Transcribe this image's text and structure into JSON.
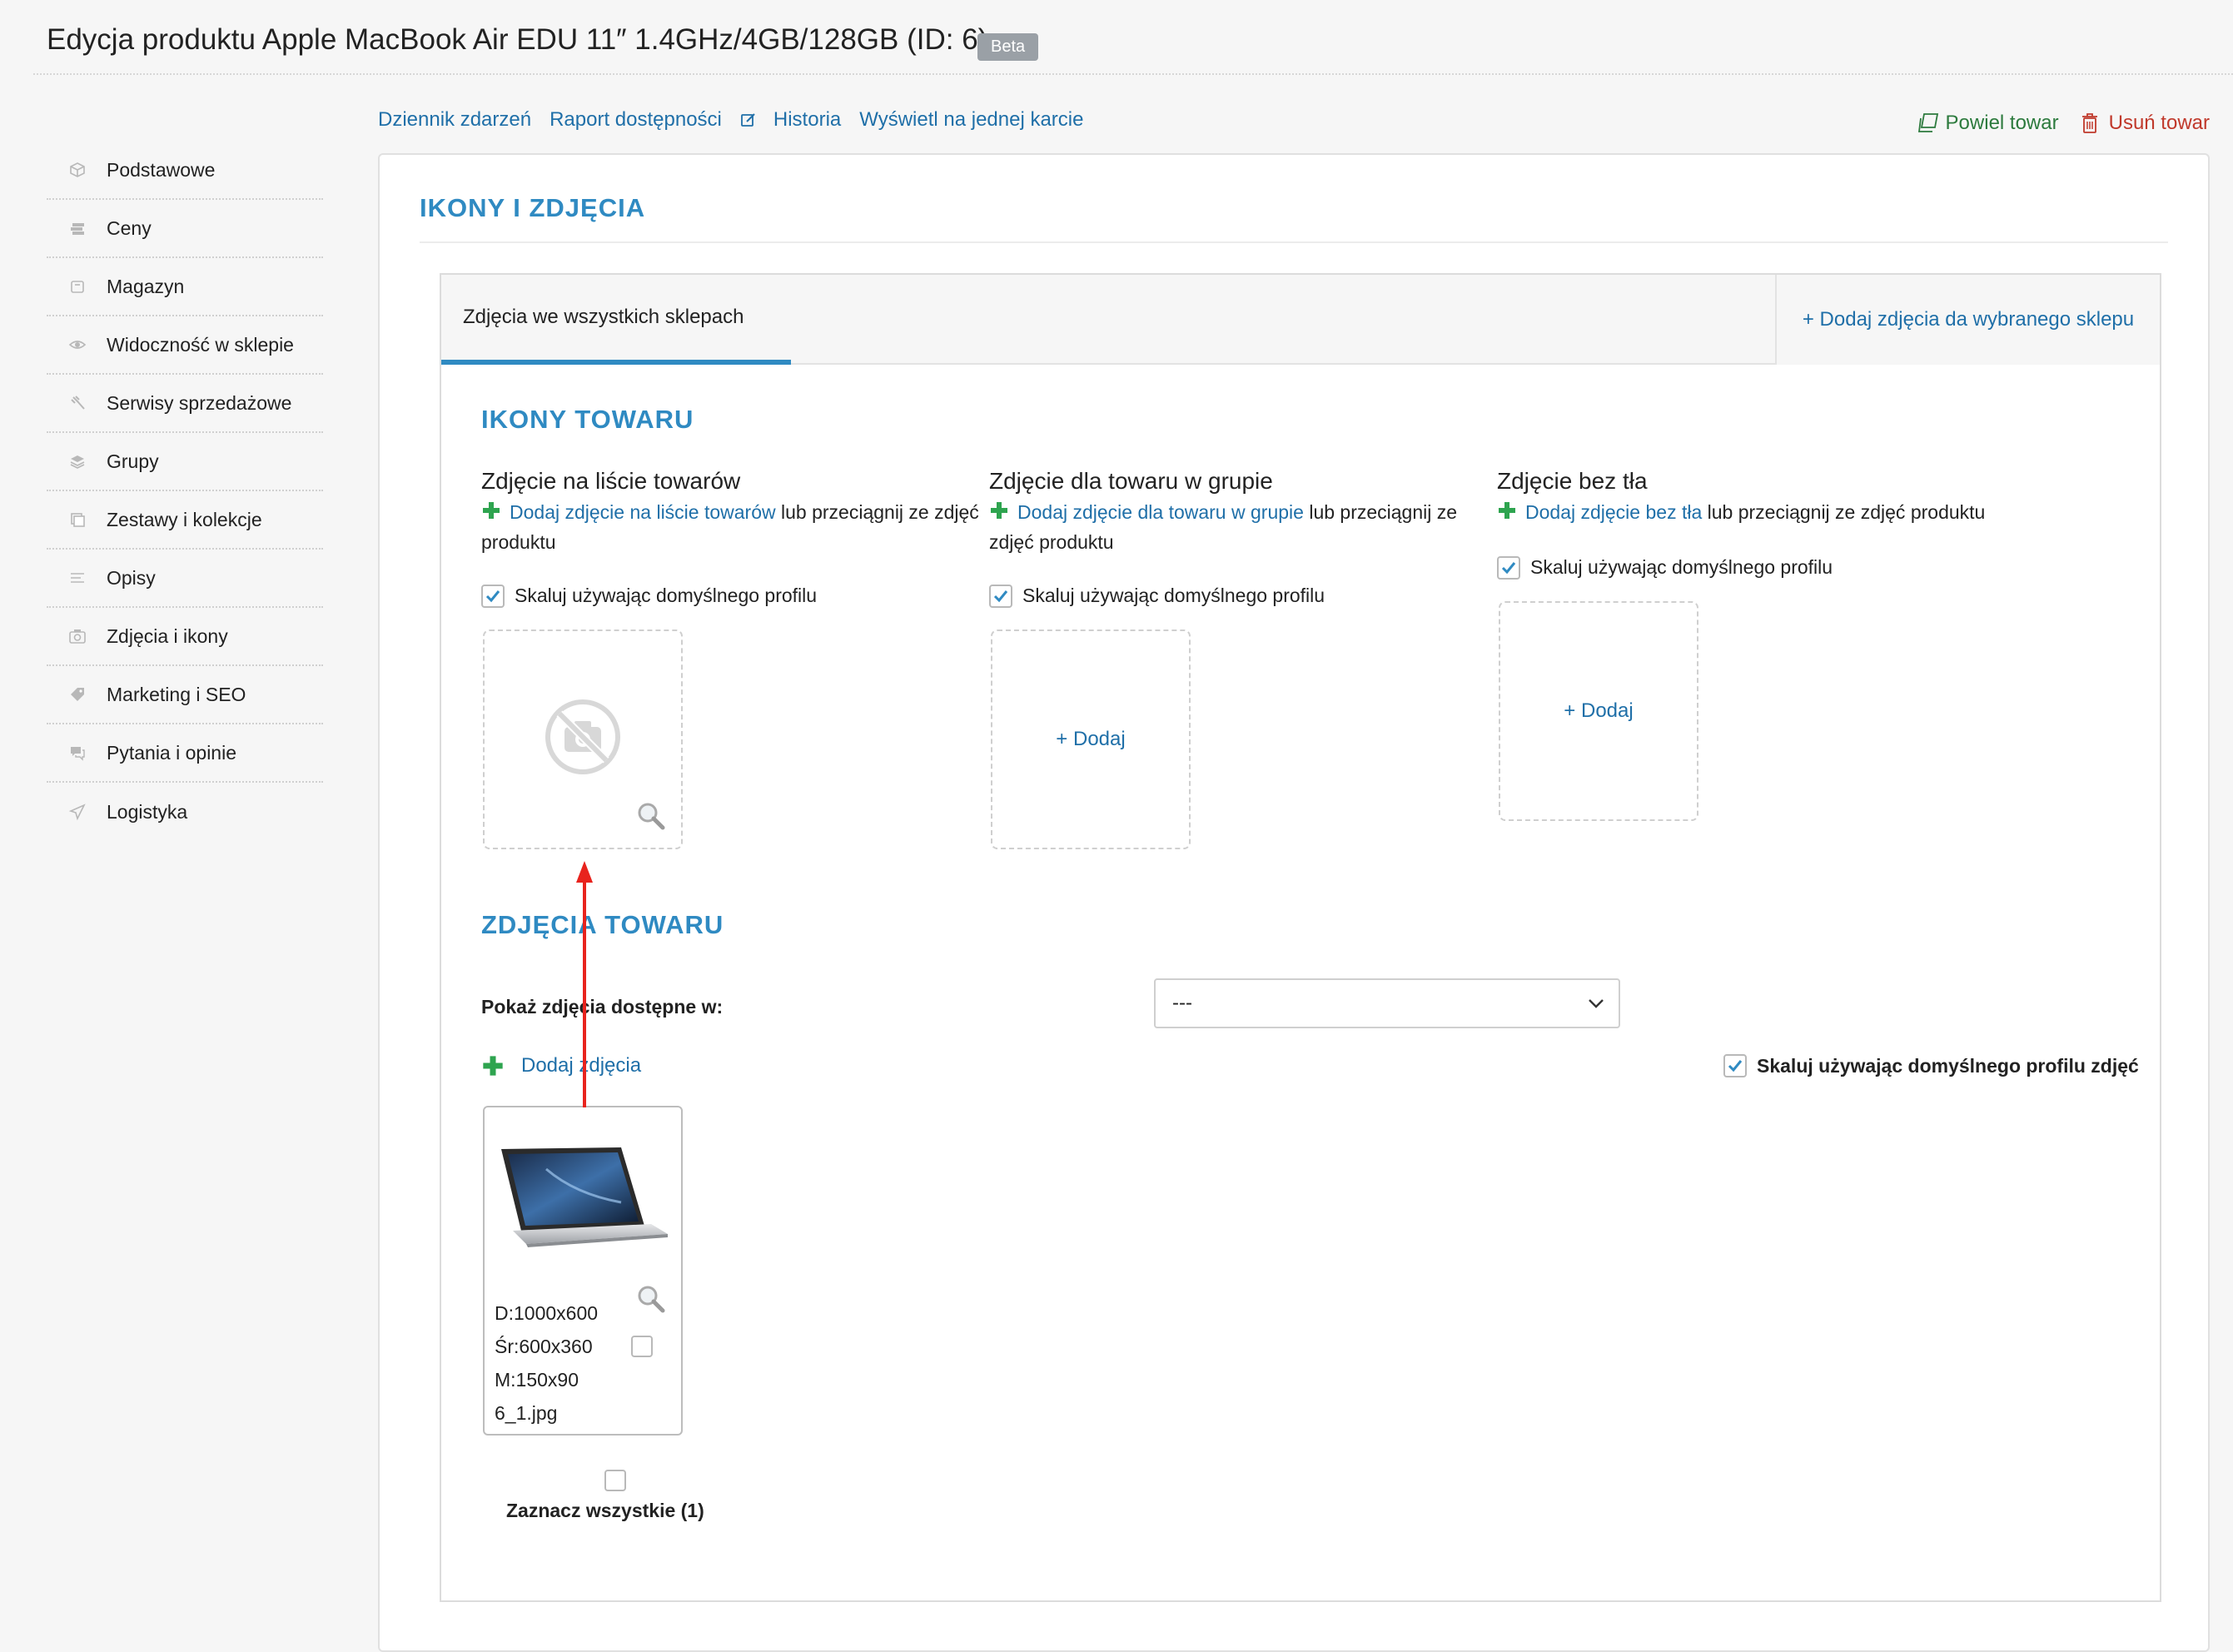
{
  "header": {
    "title": "Edycja produktu Apple MacBook Air EDU 11″ 1.4GHz/4GB/128GB (ID: 6)",
    "badge": "Beta"
  },
  "sidebar": {
    "items": [
      {
        "label": "Podstawowe",
        "icon": "box-icon"
      },
      {
        "label": "Ceny",
        "icon": "money-icon"
      },
      {
        "label": "Magazyn",
        "icon": "warehouse-icon"
      },
      {
        "label": "Widoczność w sklepie",
        "icon": "eye-icon"
      },
      {
        "label": "Serwisy sprzedażowe",
        "icon": "gavel-icon"
      },
      {
        "label": "Grupy",
        "icon": "layers-icon"
      },
      {
        "label": "Zestawy i kolekcje",
        "icon": "collection-icon"
      },
      {
        "label": "Opisy",
        "icon": "text-lines-icon"
      },
      {
        "label": "Zdjęcia i ikony",
        "icon": "camera-icon"
      },
      {
        "label": "Marketing i SEO",
        "icon": "tag-icon"
      },
      {
        "label": "Pytania i opinie",
        "icon": "chat-icon"
      },
      {
        "label": "Logistyka",
        "icon": "paper-plane-icon"
      }
    ]
  },
  "top_links": {
    "event_log": "Dziennik zdarzeń",
    "availability_report": "Raport dostępności",
    "history": "Historia",
    "single_card": "Wyświetl na jednej karcie"
  },
  "actions": {
    "clone": "Powiel towar",
    "delete": "Usuń towar"
  },
  "section": {
    "title": "IKONY I ZDJĘCIA"
  },
  "tabs": {
    "all_shops": "Zdjęcia we wszystkich sklepach",
    "add_for_shop": "+ Dodaj zdjęcia da wybranego sklepu"
  },
  "icons_section": {
    "title": "IKONY TOWARU",
    "columns": [
      {
        "heading": "Zdjęcie na liście towarów",
        "link_text": "Dodaj zdjęcie",
        "link_target": "na liście towarów",
        "suffix": "lub przeciągnij ze zdjęć produktu",
        "scale_label": "Skaluj używając domyślnego profilu",
        "scale_checked": true,
        "has_image": true,
        "add_label": ""
      },
      {
        "heading": "Zdjęcie dla towaru w grupie",
        "link_text": "Dodaj zdjęcie",
        "link_target": "dla towaru w grupie",
        "suffix": "lub przeciągnij ze zdjęć produktu",
        "scale_label": "Skaluj używając domyślnego profilu",
        "scale_checked": true,
        "has_image": false,
        "add_label": "+ Dodaj"
      },
      {
        "heading": "Zdjęcie bez tła",
        "link_text": "Dodaj zdjęcie",
        "link_target": "bez tła",
        "suffix": "lub przeciągnij ze zdjęć produktu",
        "scale_label": "Skaluj używając domyślnego profilu",
        "scale_checked": true,
        "has_image": false,
        "add_label": "+ Dodaj"
      }
    ]
  },
  "photos_section": {
    "title": "ZDJĘCIA TOWARU",
    "show_label": "Pokaż zdjęcia dostępne w:",
    "show_value": "---",
    "add_photos": "Dodaj zdjęcia",
    "scale_all_label": "Skaluj używając domyślnego profilu zdjęć",
    "scale_all_checked": true,
    "photos": [
      {
        "large": "D:1000x600",
        "medium": "Śr:600x360",
        "small": "M:150x90",
        "filename": "6_1.jpg",
        "selected": false
      }
    ],
    "select_all_label": "Zaznacz wszystkie (1)"
  },
  "colors": {
    "accent": "#2f8ac2",
    "link": "#1f6fa8",
    "clone": "#2c7a3d",
    "delete": "#c0392b",
    "plus": "#2ea44f",
    "annotation_arrow": "#e8231d"
  }
}
